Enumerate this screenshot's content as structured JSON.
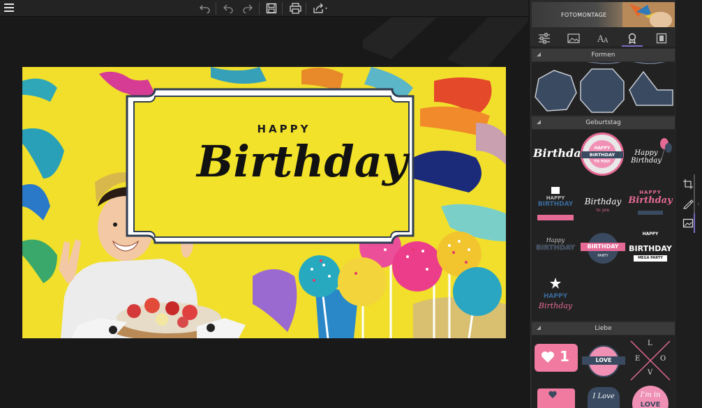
{
  "toolbar": {
    "menu_icon": "hamburger-icon",
    "undo_icon": "undo-icon",
    "redo_icon": "redo-icon",
    "redo2_icon": "redo-icon",
    "save_icon": "save-icon",
    "print_icon": "print-icon",
    "share_icon": "share-icon"
  },
  "canvas": {
    "card_line1": "HAPPY",
    "card_line2": "Birthday"
  },
  "panel": {
    "banner_title": "FOTOMONTAGE",
    "tabs": [
      {
        "icon": "sliders-icon"
      },
      {
        "icon": "image-icon"
      },
      {
        "icon": "text-icon"
      },
      {
        "icon": "badge-icon",
        "active": true
      },
      {
        "icon": "frame-icon"
      }
    ],
    "sections": {
      "formen": "Formen",
      "geburtstag": "Geburtstag",
      "liebe": "Liebe"
    },
    "stickers": {
      "b1": "Birthday",
      "b2_top": "HAPPY",
      "b2_mid": "BIRTHDAY",
      "b2_bot": "TO YOU!",
      "b3": "Happy Birthday",
      "b4_top": "HAPPY",
      "b4_bot": "BIRTHDAY",
      "b5": "Birthday",
      "b5_small": "to you",
      "b6_top": "HAPPY",
      "b6_bot": "Birthday",
      "b7_top": "Happy",
      "b7_bot": "BIRTHDAY",
      "b8_top": "BIRTHDAY",
      "b8_bot": "PARTY",
      "b9_top": "HAPPY",
      "b9_mid": "BIRTHDAY",
      "b9_bot": "MEGA PARTY",
      "b10_top": "HAPPY",
      "b10_bot": "Birthday",
      "l1": "1",
      "l2": "LOVE",
      "l3_l": "L",
      "l3_o": "O",
      "l3_v": "V",
      "l3_e": "E",
      "l5": "I Love",
      "l6_top": "I'm in",
      "l6_bot": "LOVE"
    }
  },
  "strip": {
    "crop_icon": "crop-icon",
    "pen_icon": "pen-icon",
    "photo_icon": "photo-icon"
  }
}
